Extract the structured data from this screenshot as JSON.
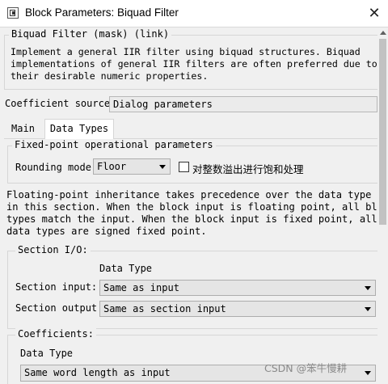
{
  "window": {
    "title": "Block Parameters: Biquad Filter",
    "icon": "block-parameters-icon",
    "close_glyph": "✕"
  },
  "mask": {
    "legend": "Biquad Filter (mask) (link)",
    "description": "Implement a general IIR filter using biquad structures. Biquad\nimplementations of general IIR filters are often preferred due to\ntheir desirable numeric properties."
  },
  "coefficient_source": {
    "label": "Coefficient source:",
    "value": "Dialog parameters"
  },
  "tabs": [
    {
      "label": "Main",
      "active": false
    },
    {
      "label": "Data Types",
      "active": true
    }
  ],
  "fixed_point": {
    "legend": "Fixed-point operational parameters",
    "rounding_label": "Rounding mode:",
    "rounding_value": "Floor",
    "saturate_label": "对整数溢出进行饱和处理",
    "saturate_checked": false
  },
  "inheritance_note": "Floating-point inheritance takes precedence over the data type settings\nin this section. When the block input is floating point, all block data\ntypes match the input. When the block input is fixed point, all internal\ndata types are signed fixed point.",
  "section_io": {
    "legend": "Section I/O:",
    "data_type_header": "Data Type",
    "input_label": "Section input:",
    "input_value": "Same as input",
    "output_label": "Section output:",
    "output_value": "Same as section input"
  },
  "coefficients": {
    "legend": "Coefficients:",
    "data_type_header": "Data Type",
    "value": "Same word length as input"
  },
  "watermark": "CSDN @笨牛慢耕"
}
